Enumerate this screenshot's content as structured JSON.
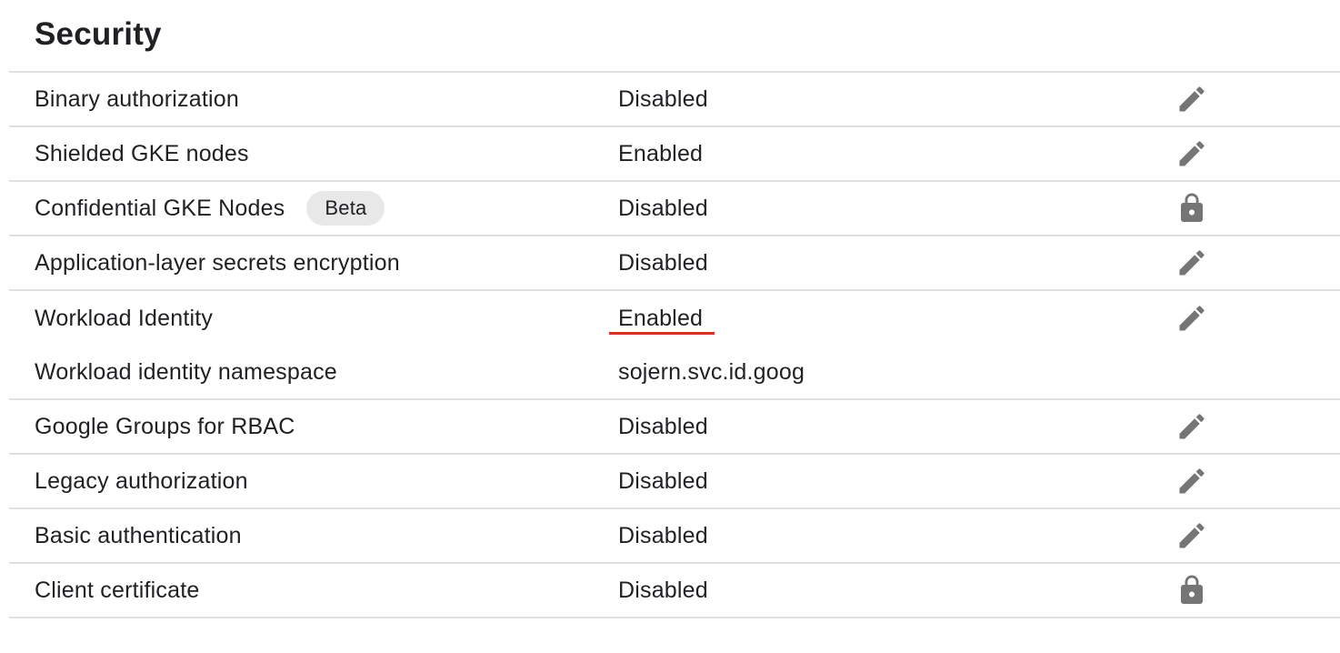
{
  "section": {
    "title": "Security"
  },
  "rows": [
    {
      "label": "Binary authorization",
      "value": "Disabled",
      "action_icon": "edit-icon"
    },
    {
      "label": "Shielded GKE nodes",
      "value": "Enabled",
      "action_icon": "edit-icon"
    },
    {
      "label": "Confidential GKE Nodes",
      "badge": "Beta",
      "value": "Disabled",
      "action_icon": "lock-icon"
    },
    {
      "label": "Application-layer secrets encryption",
      "value": "Disabled",
      "action_icon": "edit-icon"
    },
    {
      "label": "Workload Identity",
      "value": "Enabled",
      "action_icon": "edit-icon",
      "highlight_color": "#d93025"
    },
    {
      "label": "Workload identity namespace",
      "value": "sojern.svc.id.goog"
    },
    {
      "label": "Google Groups for RBAC",
      "value": "Disabled",
      "action_icon": "edit-icon"
    },
    {
      "label": "Legacy authorization",
      "value": "Disabled",
      "action_icon": "edit-icon"
    },
    {
      "label": "Basic authentication",
      "value": "Disabled",
      "action_icon": "edit-icon"
    },
    {
      "label": "Client certificate",
      "value": "Disabled",
      "action_icon": "lock-icon"
    }
  ],
  "colors": {
    "text": "#202124",
    "divider": "#e0e0e0",
    "icon": "#757575",
    "badge_bg": "#e8e8e8",
    "highlight": "#d93025"
  }
}
